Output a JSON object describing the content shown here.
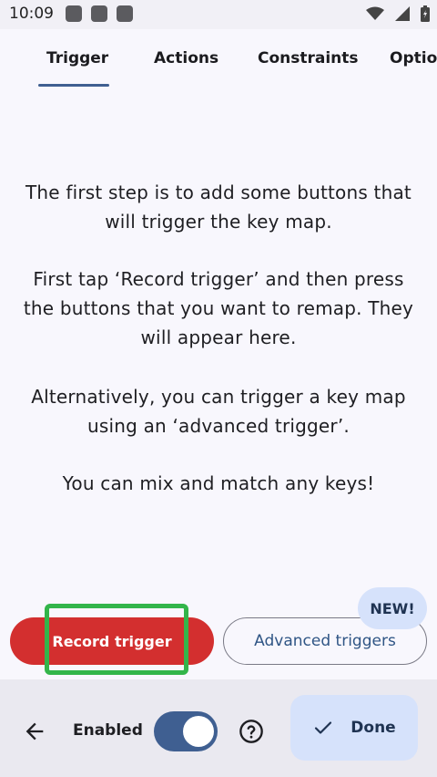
{
  "status_bar": {
    "time": "10:09"
  },
  "tabs": [
    {
      "label": "Trigger",
      "selected": true
    },
    {
      "label": "Actions"
    },
    {
      "label": "Constraints"
    },
    {
      "label": "Options"
    }
  ],
  "content": {
    "paragraphs": [
      "The first step is to add some buttons that will trigger the key map.",
      "First tap ‘Record trigger’ and then press the buttons that you want to remap. They will appear here.",
      "Alternatively, you can trigger a key map using an ‘advanced trigger’.",
      "You can mix and match any keys!"
    ]
  },
  "actions": {
    "record_label": "Record trigger",
    "advanced_label": "Advanced triggers",
    "new_badge": "NEW!"
  },
  "bottom_bar": {
    "enabled_label": "Enabled",
    "enabled": true,
    "done_label": "Done"
  },
  "colors": {
    "accent": "#3f5f91",
    "record": "#d32f2f",
    "highlight": "#33b54a",
    "tonal": "#d6e2fb"
  },
  "icons": [
    "back-arrow-icon",
    "help-icon",
    "check-icon",
    "wifi-icon",
    "signal-icon",
    "battery-icon"
  ]
}
